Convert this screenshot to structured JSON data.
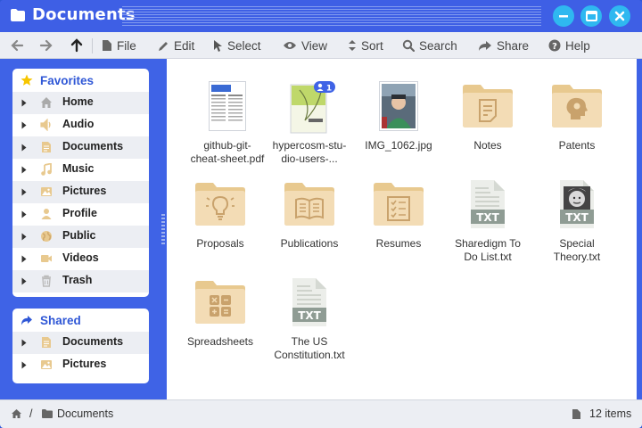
{
  "window": {
    "title": "Documents",
    "controls": [
      "minimize",
      "maximize",
      "close"
    ]
  },
  "toolbar": {
    "back_icon": "arrow-left-icon",
    "forward_icon": "arrow-right-icon",
    "up_icon": "arrow-up-icon",
    "file": "File",
    "edit": "Edit",
    "select": "Select",
    "view": "View",
    "sort": "Sort",
    "search": "Search",
    "share": "Share",
    "help": "Help"
  },
  "sidebar": {
    "favorites": {
      "title": "Favorites",
      "items": [
        {
          "label": "Home",
          "icon": "home-icon"
        },
        {
          "label": "Audio",
          "icon": "speaker-icon"
        },
        {
          "label": "Documents",
          "icon": "document-icon"
        },
        {
          "label": "Music",
          "icon": "music-note-icon"
        },
        {
          "label": "Pictures",
          "icon": "picture-icon"
        },
        {
          "label": "Profile",
          "icon": "person-icon"
        },
        {
          "label": "Public",
          "icon": "globe-icon"
        },
        {
          "label": "Videos",
          "icon": "video-camera-icon"
        },
        {
          "label": "Trash",
          "icon": "trash-icon"
        }
      ]
    },
    "shared": {
      "title": "Shared",
      "items": [
        {
          "label": "Documents",
          "icon": "document-icon"
        },
        {
          "label": "Pictures",
          "icon": "picture-icon"
        }
      ]
    }
  },
  "files": [
    {
      "name": "github-git-cheat-sheet.pdf",
      "line1": "github-git-",
      "line2": "cheat-sheet.pdf",
      "kind": "pdf-thumbnail"
    },
    {
      "name": "hypercosm-studio-users-...",
      "line1": "hypercosm-stu-",
      "line2": "dio-users-...",
      "kind": "pdf-thumbnail",
      "badge": "1"
    },
    {
      "name": "IMG_1062.jpg",
      "line1": "IMG_1062.jpg",
      "line2": "",
      "kind": "image-thumbnail"
    },
    {
      "name": "Notes",
      "line1": "Notes",
      "line2": "",
      "kind": "folder-notes-icon"
    },
    {
      "name": "Patents",
      "line1": "Patents",
      "line2": "",
      "kind": "folder-bulb-head-icon"
    },
    {
      "name": "Proposals",
      "line1": "Proposals",
      "line2": "",
      "kind": "folder-lightbulb-icon"
    },
    {
      "name": "Publications",
      "line1": "Publications",
      "line2": "",
      "kind": "folder-book-icon"
    },
    {
      "name": "Resumes",
      "line1": "Resumes",
      "line2": "",
      "kind": "folder-checklist-icon"
    },
    {
      "name": "Sharedigm To Do List.txt",
      "line1": "Sharedigm To",
      "line2": "Do List.txt",
      "kind": "txt-file-icon",
      "badge_text": "TXT"
    },
    {
      "name": "Special Theory.txt",
      "line1": "Special",
      "line2": "Theory.txt",
      "kind": "txt-file-with-photo-icon",
      "badge_text": "TXT"
    },
    {
      "name": "Spreadsheets",
      "line1": "Spreadsheets",
      "line2": "",
      "kind": "folder-calculator-icon"
    },
    {
      "name": "The US Constitution.txt",
      "line1": "The US",
      "line2": "Constitution.txt",
      "kind": "txt-file-icon",
      "badge_text": "TXT"
    }
  ],
  "status": {
    "home_icon": "home-icon",
    "separator": "/",
    "folder_icon": "folder-icon",
    "path": "Documents",
    "count": "12 items"
  },
  "colors": {
    "accent": "#3f63e6",
    "window_button": "#2fb8f0",
    "folder": "#f3dcb5",
    "folder_tab": "#e8c98f",
    "txt_badge": "#8f9c94"
  }
}
